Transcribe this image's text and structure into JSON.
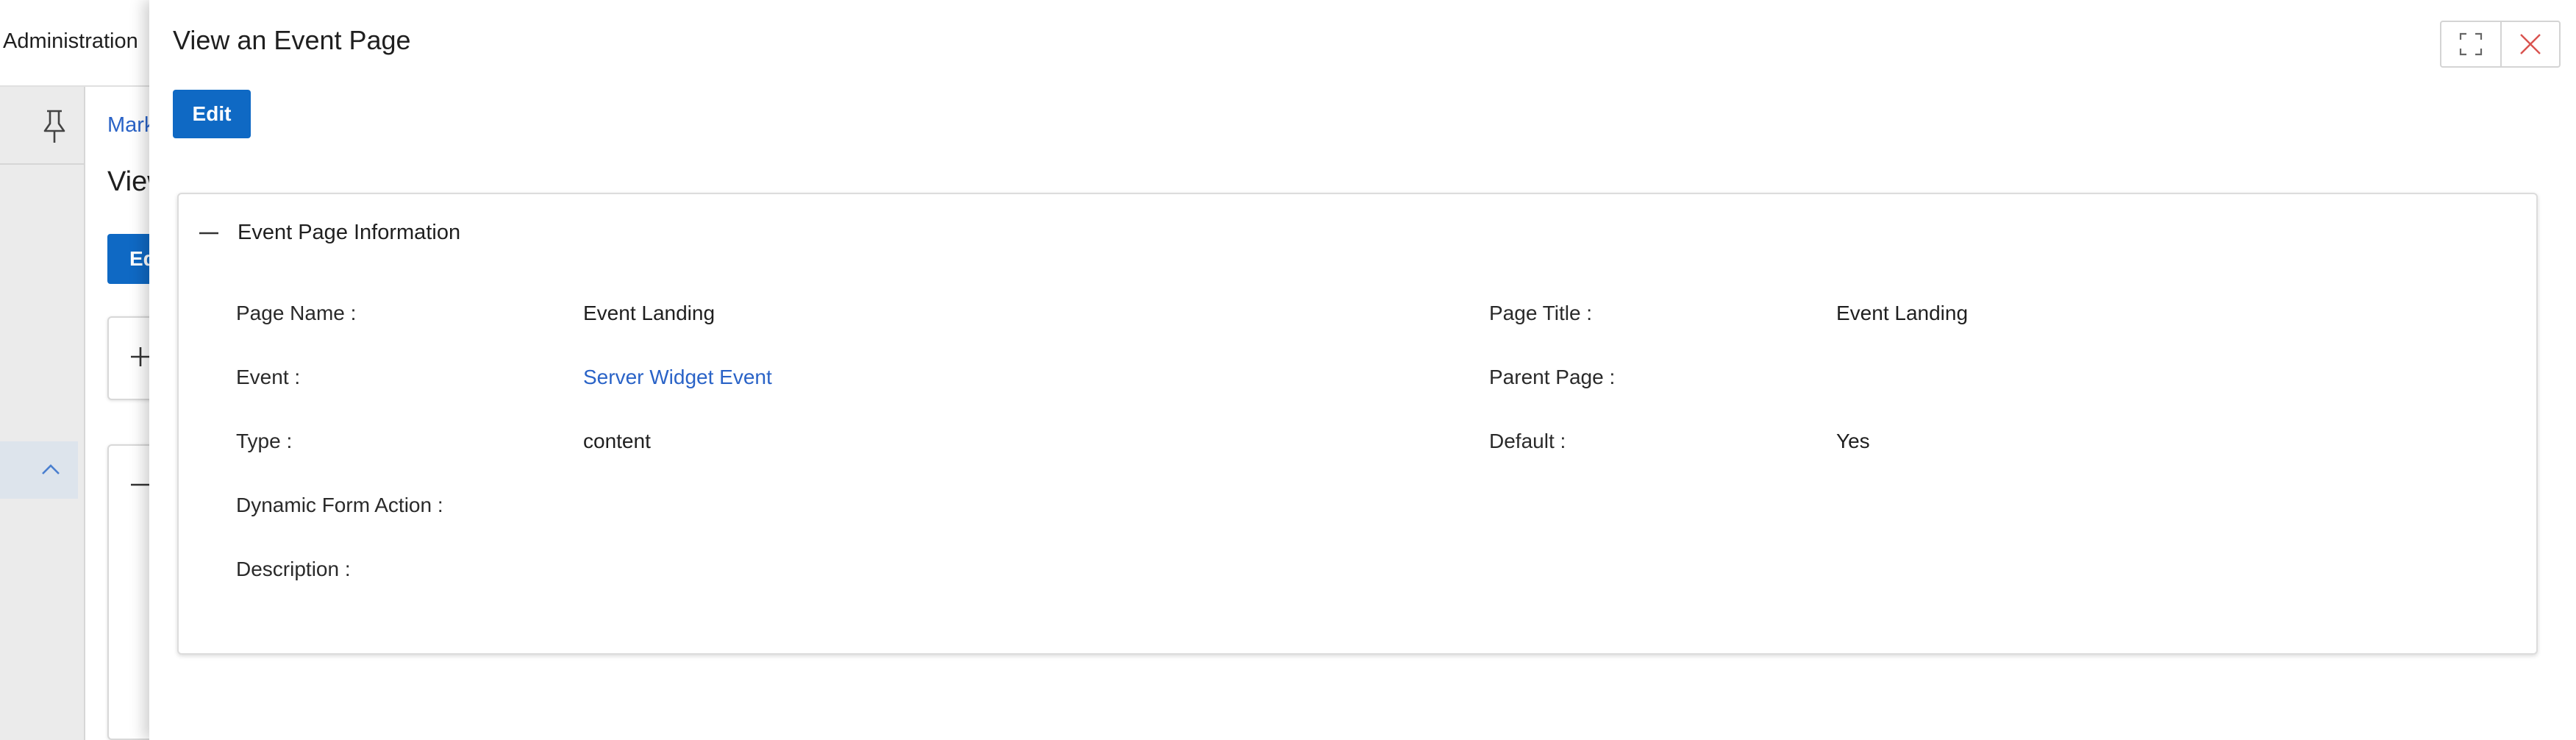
{
  "background": {
    "topbar_label": "Administration",
    "breadcrumb": "Mark",
    "page_title": "View",
    "edit_button": "Edit"
  },
  "panel": {
    "title": "View an Event Page",
    "edit_label": "Edit",
    "controls": {
      "maximize_icon": "maximize-icon",
      "close_icon": "close-icon"
    },
    "section": {
      "title": "Event Page Information",
      "collapse_icon": "minus-icon",
      "fields": {
        "page_name": {
          "label": "Page Name :",
          "value": "Event Landing"
        },
        "page_title": {
          "label": "Page Title :",
          "value": "Event Landing"
        },
        "event": {
          "label": "Event :",
          "value": "Server Widget Event"
        },
        "parent_page": {
          "label": "Parent Page :",
          "value": ""
        },
        "type": {
          "label": "Type :",
          "value": "content"
        },
        "default": {
          "label": "Default :",
          "value": "Yes"
        },
        "dynamic_form_action": {
          "label": "Dynamic Form Action :",
          "value": ""
        },
        "description": {
          "label": "Description :",
          "value": ""
        }
      }
    }
  },
  "colors": {
    "accent": "#0f69c4",
    "link": "#2a63c7",
    "close": "#d9534f"
  }
}
